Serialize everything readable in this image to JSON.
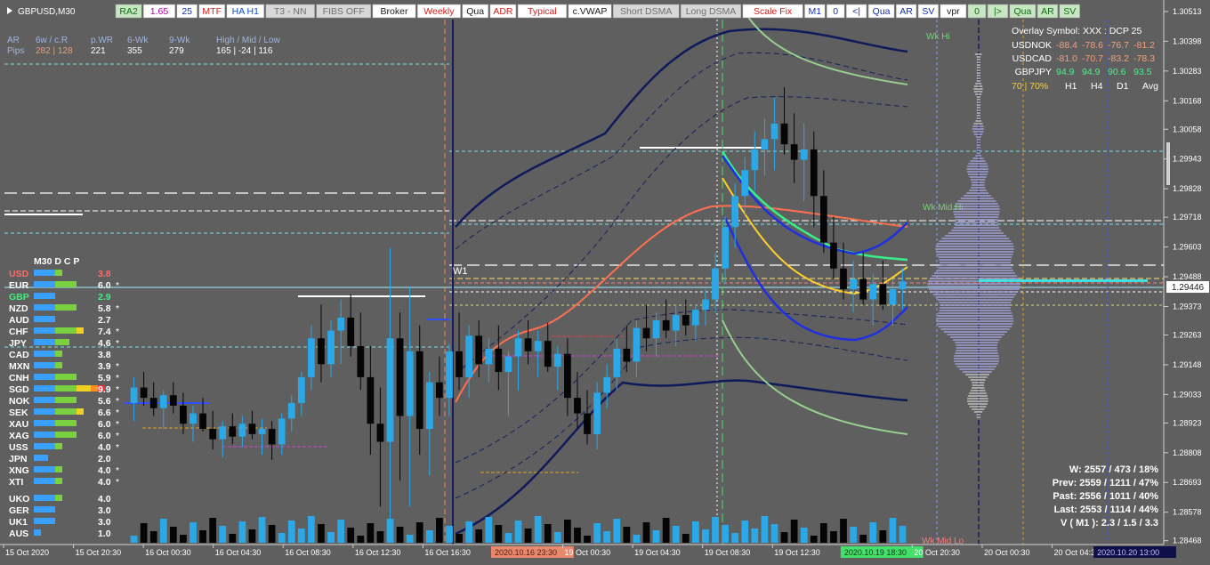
{
  "symbol_title": "GBPUSD,M30",
  "toolbar": [
    {
      "label": "RA2",
      "bg": "#c7e6c2",
      "fg": "#1a6b1a"
    },
    {
      "label": "1.65",
      "bg": "#ffffff",
      "fg": "#b000b0"
    },
    {
      "label": "25",
      "bg": "#ffffff",
      "fg": "#1030c0"
    },
    {
      "label": "MTF",
      "bg": "#ffffff",
      "fg": "#d02020"
    },
    {
      "label": "HA H1",
      "bg": "#ffffff",
      "fg": "#1050d0"
    },
    {
      "label": "T3 - NN",
      "bg": "#d8d8d8",
      "fg": "#707070"
    },
    {
      "label": "FIBS OFF",
      "bg": "#d8d8d8",
      "fg": "#707070"
    },
    {
      "label": "Broker",
      "bg": "#ffffff",
      "fg": "#202020"
    },
    {
      "label": "Weekly",
      "bg": "#ffffff",
      "fg": "#d02020"
    },
    {
      "label": "Qua",
      "bg": "#ffffff",
      "fg": "#202020"
    },
    {
      "label": "ADR",
      "bg": "#ffffff",
      "fg": "#d02020"
    },
    {
      "label": "Typical",
      "bg": "#ffffff",
      "fg": "#d02020"
    },
    {
      "label": "c.VWAP",
      "bg": "#ffffff",
      "fg": "#202020"
    },
    {
      "label": "Short DSMA",
      "bg": "#d8d8d8",
      "fg": "#707070"
    },
    {
      "label": "Long DSMA",
      "bg": "#d8d8d8",
      "fg": "#707070"
    },
    {
      "label": "Scale Fix",
      "bg": "#ffffff",
      "fg": "#d02020"
    },
    {
      "label": "M1",
      "bg": "#ffffff",
      "fg": "#1030c0"
    },
    {
      "label": "0",
      "bg": "#ffffff",
      "fg": "#1030c0"
    },
    {
      "label": "<|",
      "bg": "#ffffff",
      "fg": "#1030c0"
    },
    {
      "label": "Qua",
      "bg": "#ffffff",
      "fg": "#1030c0"
    },
    {
      "label": "AR",
      "bg": "#ffffff",
      "fg": "#1030c0"
    },
    {
      "label": "SV",
      "bg": "#ffffff",
      "fg": "#1030c0"
    },
    {
      "label": "vpr",
      "bg": "#ffffff",
      "fg": "#202020"
    },
    {
      "label": "0",
      "bg": "#c7e6c2",
      "fg": "#1a6b1a"
    },
    {
      "label": "|>",
      "bg": "#c7e6c2",
      "fg": "#1a6b1a"
    },
    {
      "label": "Qua",
      "bg": "#c7e6c2",
      "fg": "#1a6b1a"
    },
    {
      "label": "AR",
      "bg": "#c7e6c2",
      "fg": "#1a6b1a"
    },
    {
      "label": "SV",
      "bg": "#c7e6c2",
      "fg": "#1a6b1a"
    }
  ],
  "stats": {
    "headers": [
      "AR",
      "6w / c.R",
      "p.WR",
      "6-Wk",
      "9-Wk",
      "High / Mid / Low"
    ],
    "row_label": "Pips",
    "values": [
      "282 | 128",
      "221",
      "355",
      "279",
      "165 |  -24  |  116"
    ]
  },
  "overlay": {
    "title": "Overlay Symbol: XXX : DCP 25",
    "rows": [
      {
        "sym": "USDNOK",
        "vals": [
          "-88.4",
          "-78.6",
          "-76.7",
          "-81.2"
        ],
        "color": "#f3a07e"
      },
      {
        "sym": "USDCAD",
        "vals": [
          "-81.0",
          "-70.7",
          "-83.2",
          "-78.3"
        ],
        "color": "#f3a07e"
      },
      {
        "sym": "GBPJPY",
        "vals": [
          "94.9",
          "94.9",
          "90.6",
          "93.5"
        ],
        "color": "#4cf08a"
      }
    ],
    "footer_pct": "70 | 70%",
    "footer_cols": [
      "H1",
      "H4",
      "D1",
      "Avg"
    ]
  },
  "currency_panel": {
    "header": "M30   D C P",
    "rows": [
      {
        "code": "USD",
        "val": "3.8",
        "star": "",
        "color": "#ff6a6a",
        "level": 0.38
      },
      {
        "code": "EUR",
        "val": "6.0",
        "star": "*",
        "color": "#ffffff",
        "level": 0.6
      },
      {
        "code": "GBP",
        "val": "2.9",
        "star": "",
        "color": "#3ef07a",
        "level": 0.29
      },
      {
        "code": "NZD",
        "val": "5.8",
        "star": "*",
        "color": "#ffffff",
        "level": 0.58
      },
      {
        "code": "AUD",
        "val": "2.7",
        "star": "",
        "color": "#ffffff",
        "level": 0.27
      },
      {
        "code": "CHF",
        "val": "7.4",
        "star": "*",
        "color": "#ffffff",
        "level": 0.74
      },
      {
        "code": "JPY",
        "val": "4.6",
        "star": "*",
        "color": "#ffffff",
        "level": 0.46
      },
      {
        "code": "CAD",
        "val": "3.8",
        "star": "",
        "color": "#ffffff",
        "level": 0.38
      },
      {
        "code": "MXN",
        "val": "3.9",
        "star": "*",
        "color": "#ffffff",
        "level": 0.39
      },
      {
        "code": "CNH",
        "val": "5.9",
        "star": "*",
        "color": "#ffffff",
        "level": 0.59
      },
      {
        "code": "SGD",
        "val": "9.9",
        "star": "*",
        "color": "#ffffff",
        "level": 0.99
      },
      {
        "code": "NOK",
        "val": "5.6",
        "star": "*",
        "color": "#ffffff",
        "level": 0.56
      },
      {
        "code": "SEK",
        "val": "6.6",
        "star": "*",
        "color": "#ffffff",
        "level": 0.66
      },
      {
        "code": "XAU",
        "val": "6.0",
        "star": "*",
        "color": "#ffffff",
        "level": 0.6
      },
      {
        "code": "XAG",
        "val": "6.0",
        "star": "*",
        "color": "#ffffff",
        "level": 0.6
      },
      {
        "code": "USS",
        "val": "4.0",
        "star": "*",
        "color": "#ffffff",
        "level": 0.4
      },
      {
        "code": "JPN",
        "val": "2.0",
        "star": "",
        "color": "#ffffff",
        "level": 0.2
      },
      {
        "code": "XNG",
        "val": "4.0",
        "star": "*",
        "color": "#ffffff",
        "level": 0.4
      },
      {
        "code": "XTI",
        "val": "4.0",
        "star": "*",
        "color": "#ffffff",
        "level": 0.4
      },
      {
        "code": "UKO",
        "val": "4.0",
        "star": "",
        "color": "#ffffff",
        "level": 0.4
      },
      {
        "code": "GER",
        "val": "3.0",
        "star": "",
        "color": "#ffffff",
        "level": 0.3
      },
      {
        "code": "UK1",
        "val": "3.0",
        "star": "",
        "color": "#ffffff",
        "level": 0.3
      },
      {
        "code": "AUS",
        "val": "1.0",
        "star": "",
        "color": "#ffffff",
        "level": 0.1
      }
    ]
  },
  "summary": [
    "W: 2557 / 473 / 18%",
    "Prev: 2559 / 1211 / 47%",
    "Past: 2556 / 1011 / 40%",
    "Last: 2553 / 1114 / 44%",
    "V ( M1 ): 2.3 / 1.5 / 3.3"
  ],
  "labels": {
    "w1": "W1",
    "wk_hi": "Wk Hi",
    "wk_mid_hi": "Wk Mid Hi",
    "wk_mid_lo": "Wk Mid Lo"
  },
  "chart_data": {
    "type": "candlestick",
    "symbol": "GBPUSD",
    "timeframe": "M30",
    "ylim": [
      1.2846,
      1.3053
    ],
    "current_price": 1.29446,
    "price_ticks": [
      "1.30513",
      "1.30398",
      "1.30283",
      "1.30168",
      "1.30058",
      "1.29943",
      "1.29828",
      "1.29718",
      "1.29603",
      "1.29488",
      "1.29373",
      "1.29263",
      "1.29148",
      "1.29033",
      "1.28923",
      "1.28808",
      "1.28693",
      "1.28578",
      "1.28468"
    ],
    "time_ticks": [
      "15 Oct 2020",
      "15 Oct 20:30",
      "16 Oct 00:30",
      "16 Oct 04:30",
      "16 Oct 08:30",
      "16 Oct 12:30",
      "16 Oct 16:30",
      "2020.10.16 23:30",
      "19 Oct 00:30",
      "19 Oct 04:30",
      "19 Oct 08:30",
      "19 Oct 12:30",
      "2020.10.19 18:30",
      "20 Oct 20:30",
      "20 Oct 00:30",
      "20 Oct 04:30",
      "2020.10.20 13:00"
    ],
    "highlighted_time_labels": [
      {
        "text": "2020.10.16 23:30",
        "bg": "#e8896e",
        "fg": "#4a1a10"
      },
      {
        "text": "2020.10.19 18:30",
        "bg": "#44e06a",
        "fg": "#0a3a14"
      },
      {
        "text": "2020.10.20 13:00",
        "bg": "#0f0f4a",
        "fg": "#c0c0ff"
      }
    ],
    "candles": [
      [
        1.29,
        1.291,
        1.2893,
        1.2906
      ],
      [
        1.2906,
        1.2912,
        1.2899,
        1.2902
      ],
      [
        1.2902,
        1.2908,
        1.2895,
        1.2898
      ],
      [
        1.2898,
        1.2905,
        1.289,
        1.2903
      ],
      [
        1.2903,
        1.2908,
        1.2896,
        1.2899
      ],
      [
        1.2899,
        1.2904,
        1.2888,
        1.2892
      ],
      [
        1.2892,
        1.2899,
        1.2885,
        1.2896
      ],
      [
        1.2896,
        1.2902,
        1.2889,
        1.289
      ],
      [
        1.289,
        1.2897,
        1.2882,
        1.2886
      ],
      [
        1.2886,
        1.2893,
        1.2879,
        1.2891
      ],
      [
        1.2891,
        1.2896,
        1.2884,
        1.2887
      ],
      [
        1.2887,
        1.2895,
        1.2883,
        1.2892
      ],
      [
        1.2892,
        1.2897,
        1.2886,
        1.2888
      ],
      [
        1.2888,
        1.2894,
        1.288,
        1.289
      ],
      [
        1.289,
        1.2893,
        1.2878,
        1.2884
      ],
      [
        1.2884,
        1.2896,
        1.288,
        1.2894
      ],
      [
        1.2894,
        1.2903,
        1.2889,
        1.29
      ],
      [
        1.29,
        1.2912,
        1.2895,
        1.291
      ],
      [
        1.291,
        1.293,
        1.2905,
        1.2925
      ],
      [
        1.2925,
        1.2938,
        1.2908,
        1.2915
      ],
      [
        1.2915,
        1.2932,
        1.291,
        1.2928
      ],
      [
        1.2928,
        1.294,
        1.2915,
        1.2933
      ],
      [
        1.2933,
        1.2942,
        1.2918,
        1.2922
      ],
      [
        1.2922,
        1.2935,
        1.2905,
        1.291
      ],
      [
        1.291,
        1.2922,
        1.288,
        1.2892
      ],
      [
        1.2892,
        1.2906,
        1.286,
        1.2885
      ],
      [
        1.2885,
        1.296,
        1.2855,
        1.2925
      ],
      [
        1.2925,
        1.2935,
        1.287,
        1.2895
      ],
      [
        1.2895,
        1.2945,
        1.286,
        1.292
      ],
      [
        1.292,
        1.293,
        1.288,
        1.289
      ],
      [
        1.289,
        1.2912,
        1.2872,
        1.2908
      ],
      [
        1.2908,
        1.2918,
        1.2895,
        1.2902
      ],
      [
        1.2902,
        1.2923,
        1.2895,
        1.292
      ],
      [
        1.292,
        1.2935,
        1.2905,
        1.291
      ],
      [
        1.291,
        1.293,
        1.2902,
        1.2926
      ],
      [
        1.2926,
        1.2932,
        1.291,
        1.2915
      ],
      [
        1.2915,
        1.2925,
        1.2908,
        1.2921
      ],
      [
        1.2921,
        1.293,
        1.2905,
        1.2912
      ],
      [
        1.2912,
        1.292,
        1.2895,
        1.2918
      ],
      [
        1.2918,
        1.2928,
        1.2905,
        1.2925
      ],
      [
        1.2925,
        1.2932,
        1.2915,
        1.292
      ],
      [
        1.292,
        1.2928,
        1.291,
        1.2924
      ],
      [
        1.2924,
        1.2931,
        1.2912,
        1.2914
      ],
      [
        1.2914,
        1.2922,
        1.2905,
        1.2919
      ],
      [
        1.2919,
        1.2925,
        1.2895,
        1.2902
      ],
      [
        1.2902,
        1.2912,
        1.289,
        1.2896
      ],
      [
        1.2896,
        1.2905,
        1.2884,
        1.2888
      ],
      [
        1.2888,
        1.2908,
        1.2882,
        1.2904
      ],
      [
        1.2904,
        1.2915,
        1.2898,
        1.291
      ],
      [
        1.291,
        1.2925,
        1.2905,
        1.2921
      ],
      [
        1.2921,
        1.293,
        1.2912,
        1.2916
      ],
      [
        1.2916,
        1.2932,
        1.291,
        1.2929
      ],
      [
        1.2929,
        1.2938,
        1.292,
        1.2925
      ],
      [
        1.2925,
        1.2935,
        1.2918,
        1.2932
      ],
      [
        1.2932,
        1.294,
        1.2925,
        1.2928
      ],
      [
        1.2928,
        1.2938,
        1.2922,
        1.2934
      ],
      [
        1.2934,
        1.294,
        1.2926,
        1.293
      ],
      [
        1.293,
        1.2938,
        1.2924,
        1.2936
      ],
      [
        1.2936,
        1.2944,
        1.293,
        1.294
      ],
      [
        1.294,
        1.2958,
        1.2935,
        1.2952
      ],
      [
        1.2952,
        1.2972,
        1.2946,
        1.2968
      ],
      [
        1.2968,
        1.2985,
        1.296,
        1.298
      ],
      [
        1.298,
        1.2995,
        1.2972,
        1.299
      ],
      [
        1.299,
        1.3005,
        1.2982,
        1.2998
      ],
      [
        1.2998,
        1.301,
        1.2988,
        1.3002
      ],
      [
        1.3002,
        1.3018,
        1.299,
        1.3008
      ],
      [
        1.3008,
        1.3022,
        1.2996,
        1.3
      ],
      [
        1.3,
        1.3012,
        1.2985,
        1.2994
      ],
      [
        1.2994,
        1.3008,
        1.2978,
        1.2998
      ],
      [
        1.2998,
        1.3005,
        1.2968,
        1.298
      ],
      [
        1.298,
        1.299,
        1.2958,
        1.2962
      ],
      [
        1.2962,
        1.2972,
        1.2948,
        1.2952
      ],
      [
        1.2952,
        1.2962,
        1.294,
        1.2944
      ],
      [
        1.2944,
        1.2955,
        1.2935,
        1.2948
      ],
      [
        1.2948,
        1.2958,
        1.2938,
        1.294
      ],
      [
        1.294,
        1.295,
        1.293,
        1.2946
      ],
      [
        1.2946,
        1.2955,
        1.2936,
        1.2938
      ],
      [
        1.2938,
        1.2948,
        1.293,
        1.2944
      ],
      [
        1.2944,
        1.2952,
        1.2936,
        1.2947
      ]
    ]
  }
}
